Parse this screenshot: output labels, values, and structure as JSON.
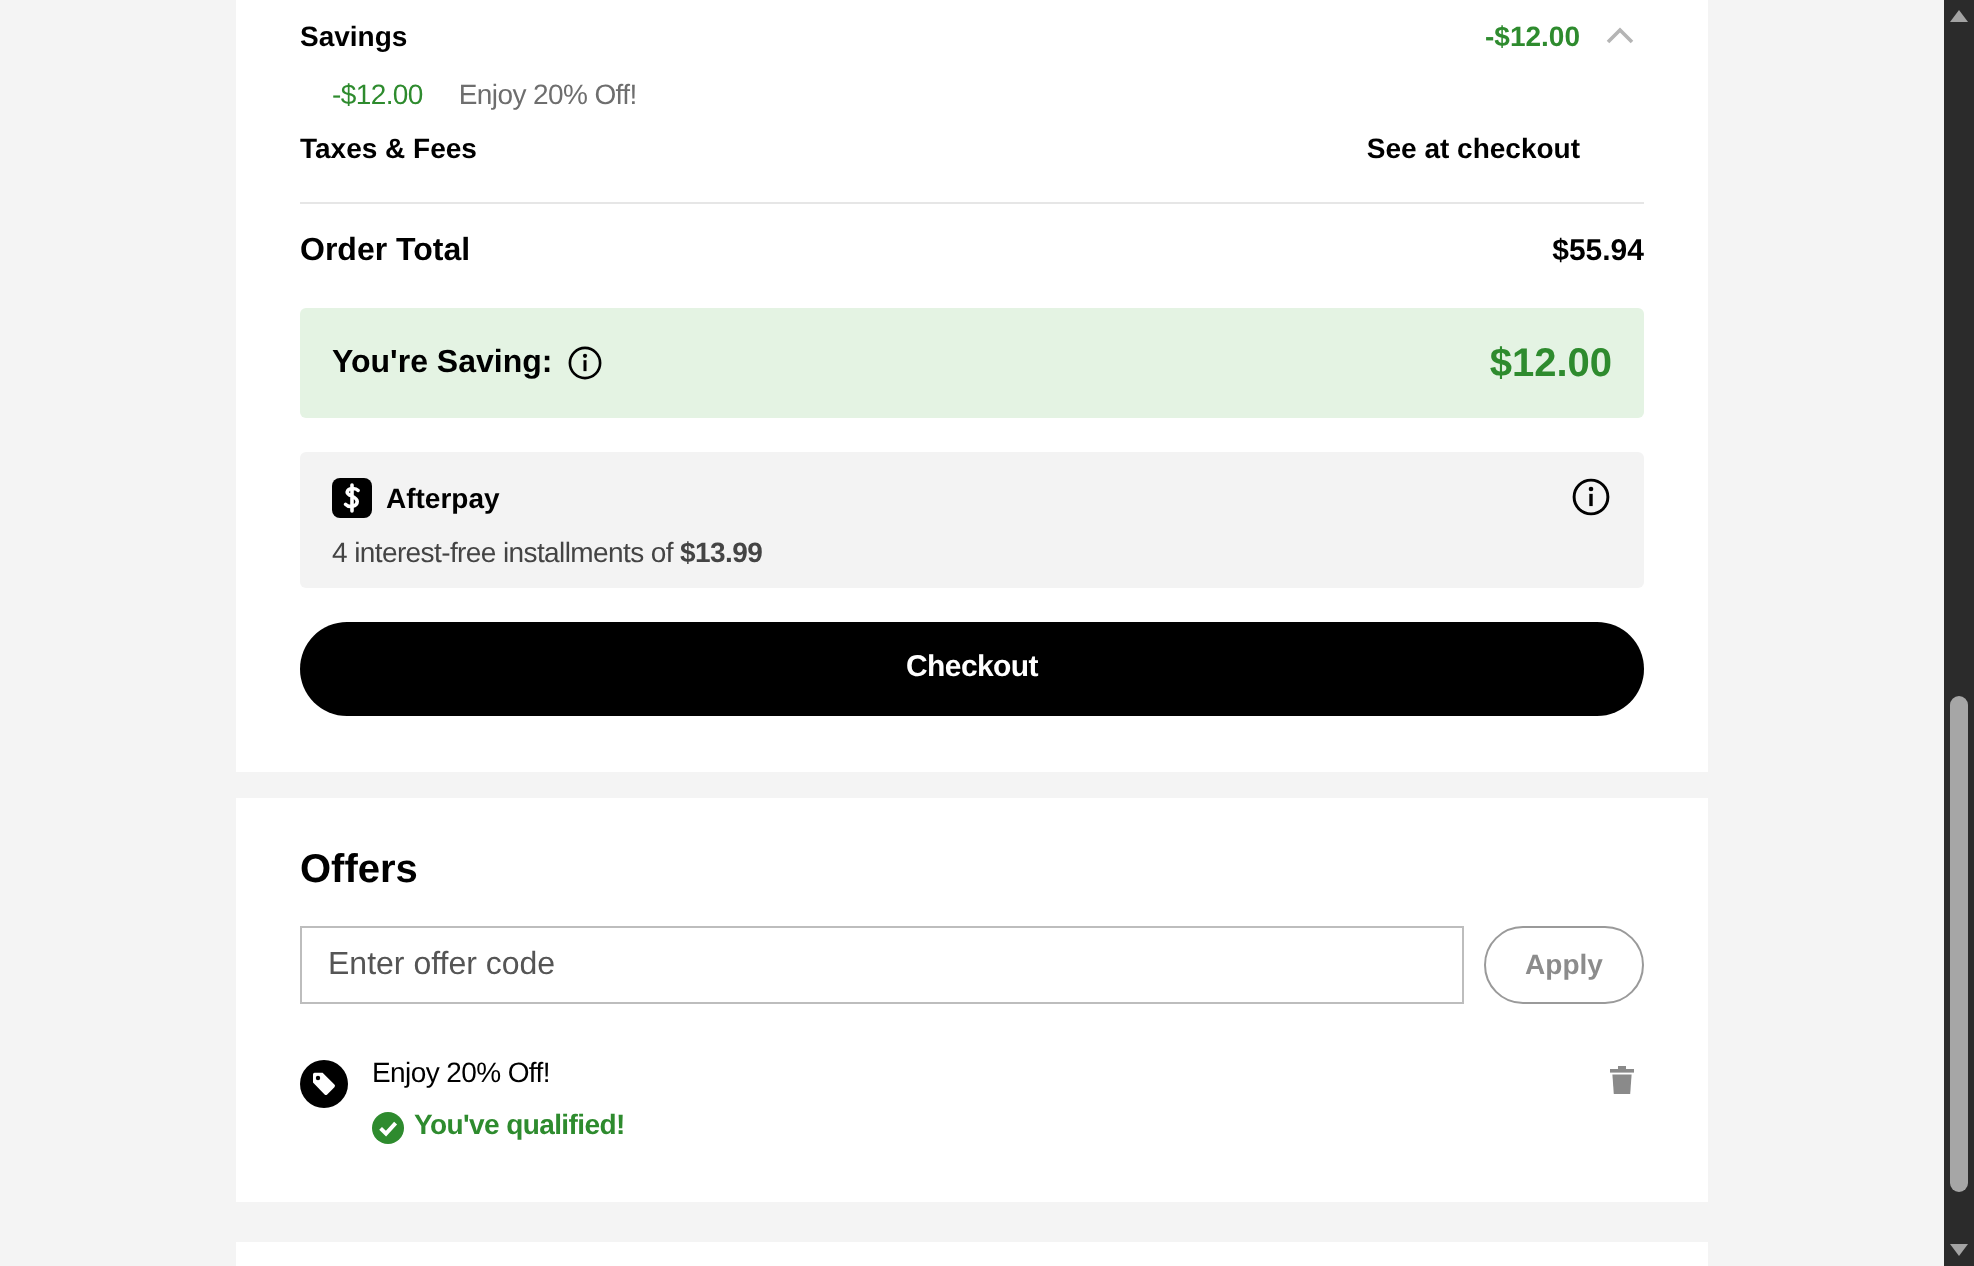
{
  "order_summary": {
    "savings": {
      "label": "Savings",
      "amount": "-$12.00",
      "expanded": true,
      "items": [
        {
          "amount": "-$12.00",
          "label": "Enjoy 20% Off!"
        }
      ]
    },
    "taxes": {
      "label": "Taxes & Fees",
      "value": "See at checkout"
    },
    "order_total": {
      "label": "Order Total",
      "value": "$55.94"
    },
    "saving_banner": {
      "label": "You're Saving:",
      "amount": "$12.00"
    },
    "afterpay": {
      "name": "Afterpay",
      "text": "4 interest-free installments of **$13.99**"
    },
    "checkout_button": {
      "label": "Checkout"
    }
  },
  "offers": {
    "title": "Offers",
    "code_field": {
      "placeholder": "Enter offer code"
    },
    "apply_button": {
      "label": "Apply",
      "disabled": true
    },
    "applied": [
      {
        "name": "Enjoy 20% Off!",
        "status": "You've qualified!"
      }
    ]
  }
}
